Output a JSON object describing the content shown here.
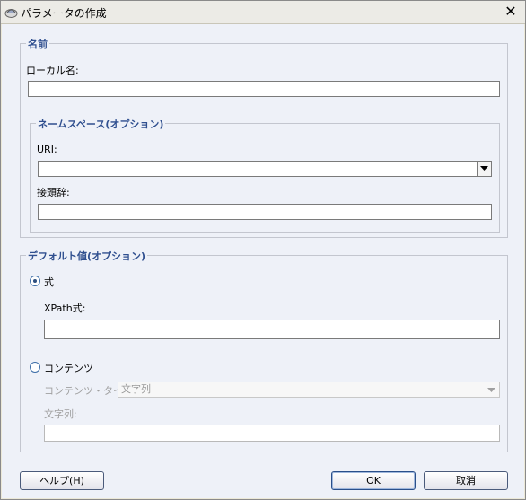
{
  "window": {
    "title": "パラメータの作成"
  },
  "name_group": {
    "legend": "名前",
    "local_name_label": "ローカル名:",
    "local_name_value": ""
  },
  "namespace_group": {
    "legend": "ネームスペース(オプション)",
    "uri_label": "URI:",
    "uri_value": "",
    "prefix_label": "接頭辞:",
    "prefix_value": ""
  },
  "default_group": {
    "legend": "デフォルト値(オプション)",
    "expression_radio": "式",
    "expression_selected": true,
    "xpath_label": "XPath式:",
    "xpath_value": "",
    "content_radio": "コンテンツ",
    "content_type_label": "コンテンツ・タイプ:",
    "content_type_value": "文字列",
    "string_label": "文字列:",
    "string_value": ""
  },
  "buttons": {
    "help": "ヘルプ(H)",
    "ok": "OK",
    "cancel": "取消"
  }
}
